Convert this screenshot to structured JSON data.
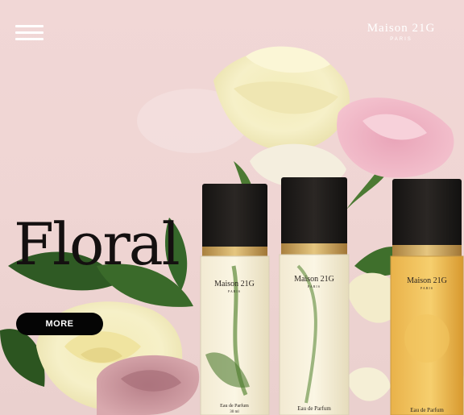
{
  "header": {
    "brand_name": "Maison 21G",
    "brand_city": "PARIS"
  },
  "hero": {
    "headline": "Floral",
    "cta_label": "MORE"
  },
  "bottles": [
    {
      "brand": "Maison 21G",
      "city": "PARIS",
      "type": "Eau de Parfum",
      "volume": "30 ml"
    },
    {
      "brand": "Maison 21G",
      "city": "PARIS",
      "type": "Eau de Parfum"
    },
    {
      "brand": "Maison 21G",
      "city": "PARIS",
      "type": "Eau de Parfum"
    }
  ],
  "colors": {
    "background": "#efd5d3",
    "button": "#050505",
    "headline": "#141010",
    "cap": "#1e1b19",
    "gold": "#c8a25a"
  },
  "icons": [
    "hamburger-menu-icon"
  ]
}
